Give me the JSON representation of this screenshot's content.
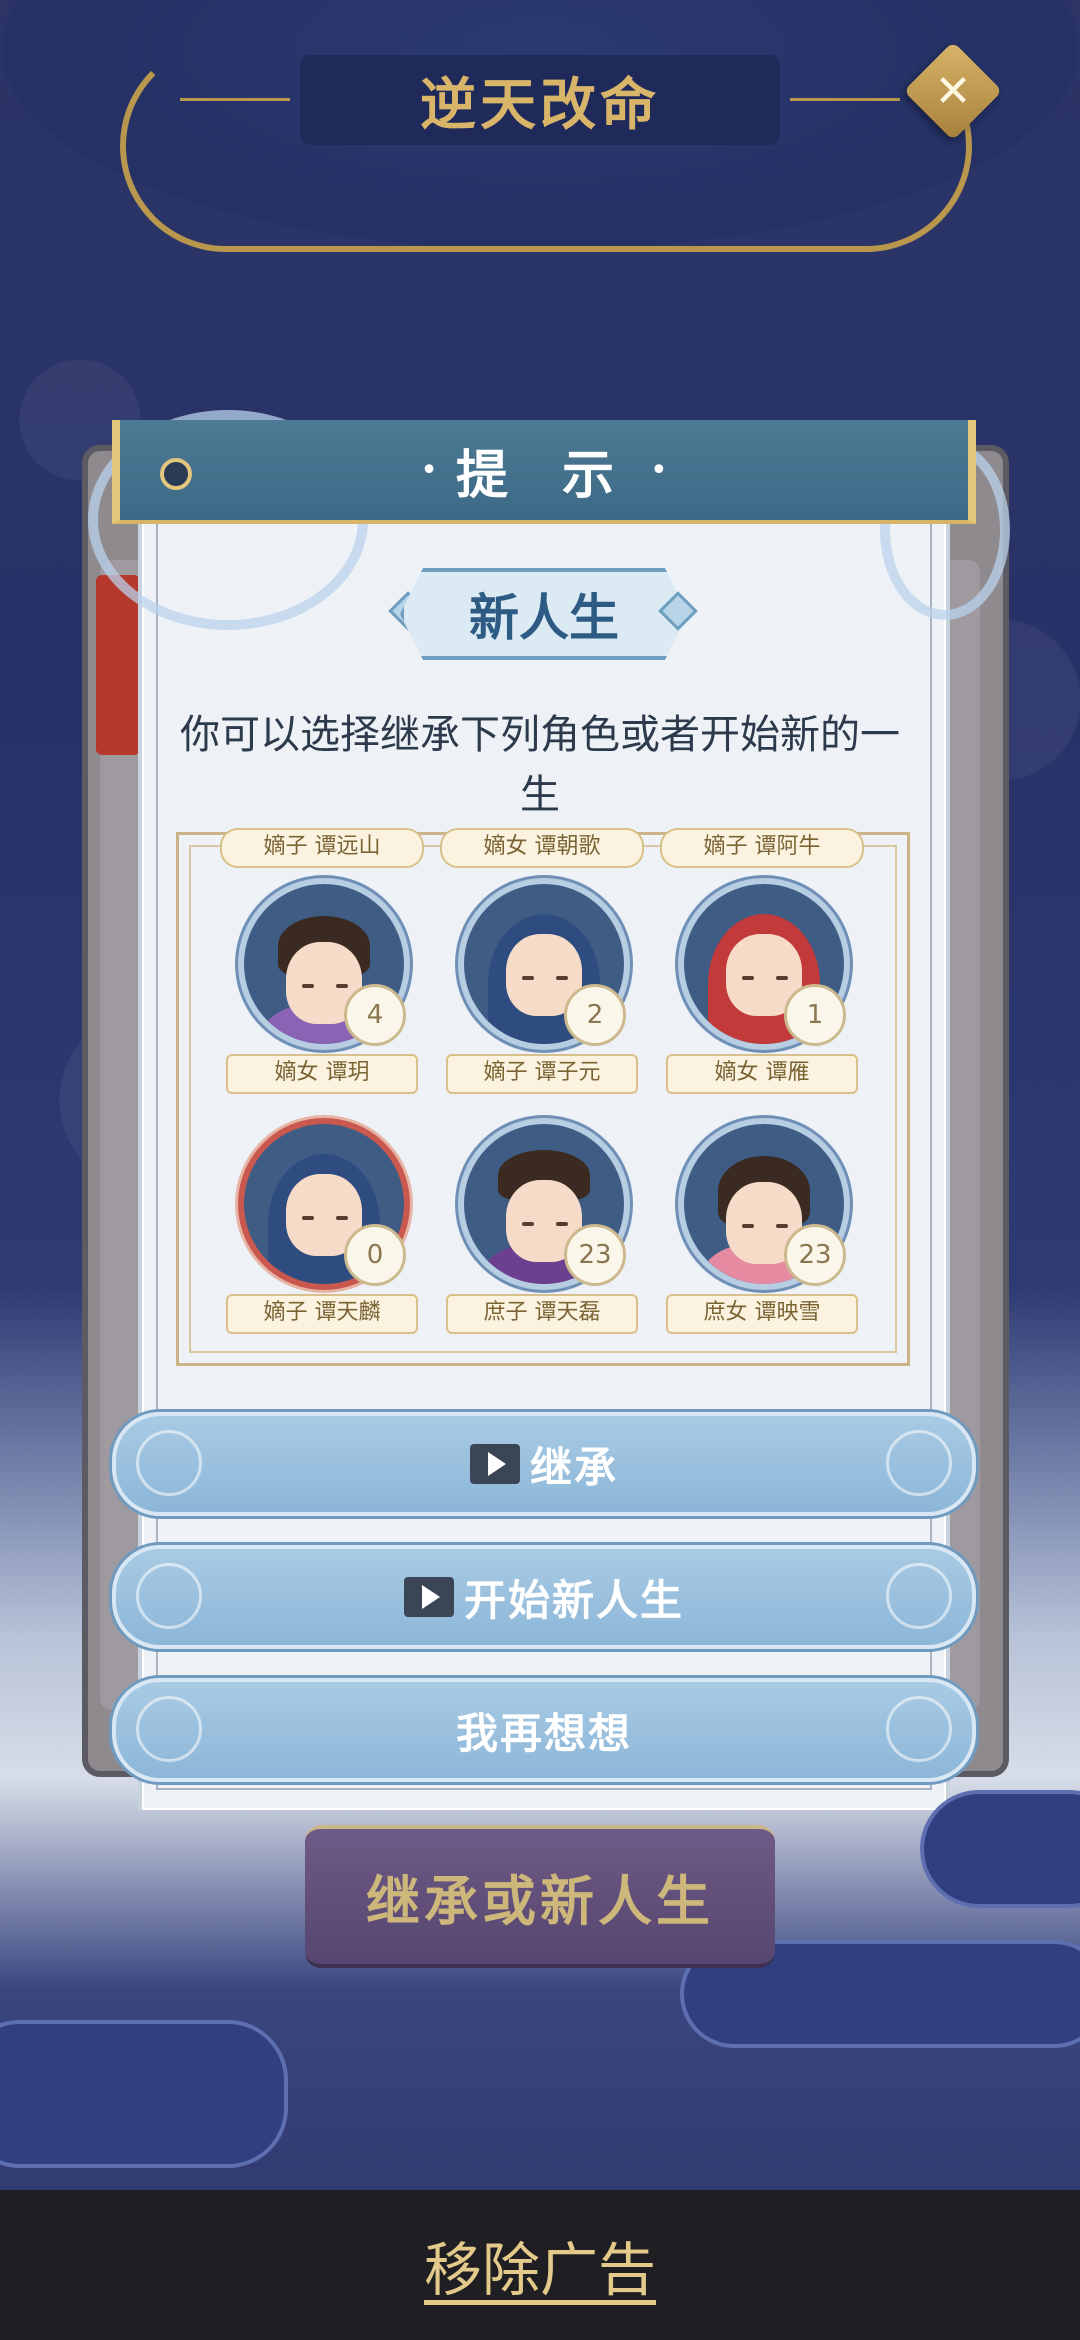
{
  "header": {
    "title": "逆天改命",
    "close_symbol": "✕"
  },
  "dialog": {
    "title": "提 示",
    "subtitle": "新人生",
    "message": "你可以选择继承下列角色或者开始新的一生"
  },
  "characters": [
    {
      "top_label": "嫡子 谭远山",
      "bottom_label": "嫡女 谭玥",
      "count": "4"
    },
    {
      "top_label": "嫡女 谭朝歌",
      "bottom_label": "嫡子 谭子元",
      "count": "2"
    },
    {
      "top_label": "嫡子 谭阿牛",
      "bottom_label": "嫡女 谭雁",
      "count": "1"
    },
    {
      "top_label": "",
      "bottom_label": "嫡子 谭天麟",
      "count": "0"
    },
    {
      "top_label": "",
      "bottom_label": "庶子 谭天磊",
      "count": "23"
    },
    {
      "top_label": "",
      "bottom_label": "庶女 谭映雪",
      "count": "23"
    }
  ],
  "buttons": {
    "inherit": "继承",
    "new_life": "开始新人生",
    "think": "我再想想"
  },
  "main_action": "继承或新人生",
  "ad": {
    "remove_label": "移除广告"
  },
  "colors": {
    "background": "#2c3566",
    "gold": "#d9b56a",
    "dialog_header": "#3c6a86",
    "button": "#8cb6d8"
  }
}
